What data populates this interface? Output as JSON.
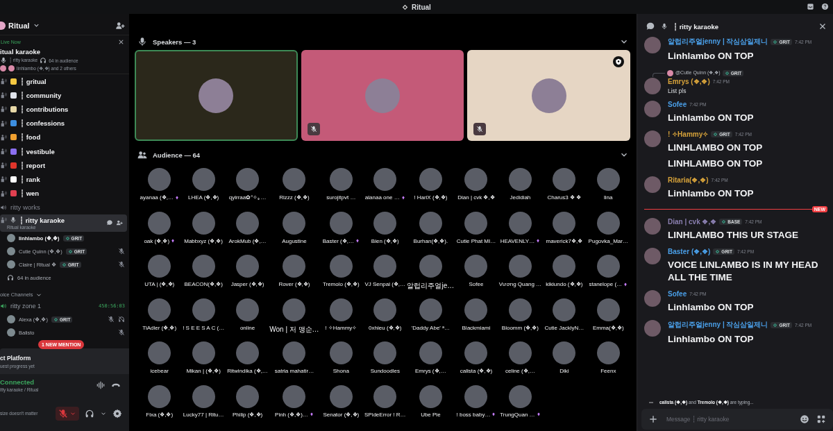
{
  "window": {
    "title": "Ritual"
  },
  "server": {
    "name": "Ritual"
  },
  "live_now": {
    "label": "Live Now",
    "title": "itual karaoke",
    "channel": "┆ ritty karaoke",
    "audience": "64 in audience",
    "speakers": "linhlambo (❖,❖) and 2 others"
  },
  "channels": [
    {
      "name": "┆ gritual",
      "kind": "text",
      "color": "#f5c842"
    },
    {
      "name": "┆ community",
      "kind": "text",
      "color": "#dfe3ea"
    },
    {
      "name": "┆ contributions",
      "kind": "text",
      "color": "#e8d9a8"
    },
    {
      "name": "┆ confessions",
      "kind": "text",
      "color": "#3d8fe0"
    },
    {
      "name": "┆ food",
      "kind": "text",
      "color": "#f0a030"
    },
    {
      "name": "┆ vestibule",
      "kind": "text",
      "color": "#8b6ff0"
    },
    {
      "name": "┆ report",
      "kind": "text",
      "color": "#e0352b"
    },
    {
      "name": "┆ rank",
      "kind": "text",
      "color": "#ffffff"
    },
    {
      "name": "┆ wen",
      "kind": "text",
      "color": "#e04050"
    },
    {
      "name": "ritty works",
      "kind": "voice"
    }
  ],
  "stage_channel": {
    "name": "┆ ritty karaoke",
    "subtitle": "Ritual karaoke",
    "selected": true,
    "audience": "64 in audience",
    "speakers": [
      {
        "name": "linhlambo (❖,❖)",
        "tag": "GRIT",
        "muted": false
      },
      {
        "name": "Cutie Quinn (❖,❖)",
        "tag": "GRIT",
        "muted": true
      },
      {
        "name": "Claire | Ritual ❖",
        "tag": "GRIT",
        "muted": true
      }
    ]
  },
  "voice_section": {
    "label": "oice Channels",
    "channel": "ritty zone 1",
    "timer": "450:56:03",
    "members": [
      {
        "name": "Alexa (❖,❖)",
        "tag": "GRIT",
        "muted": true,
        "deafened": true
      },
      {
        "name": "Balisto",
        "muted": true,
        "deafened": false
      }
    ]
  },
  "mention_badge": "1 NEW MENTION",
  "quest": {
    "title": "ct Platform",
    "subtitle": "uest progress yet"
  },
  "connection": {
    "status": "Connected",
    "channel": "itty karaoke / Ritual"
  },
  "user_panel": {
    "status": "size doesn't matter",
    "mic_muted": true
  },
  "speakers_section": {
    "title": "Speakers — 3",
    "tiles": [
      {
        "color": "#2b281b",
        "speaking": true,
        "muted": false,
        "moderator": false
      },
      {
        "color": "#c45a78",
        "speaking": false,
        "muted": true,
        "moderator": false
      },
      {
        "color": "#e6d6c4",
        "speaking": false,
        "muted": true,
        "moderator": true
      }
    ]
  },
  "audience_section": {
    "title": "Audience — 64",
    "members": [
      {
        "name": "ayanaa (❖,…",
        "boost": true
      },
      {
        "name": "LHEA (❖,❖)",
        "boost": false
      },
      {
        "name": "qyirraa✿°✧｡…",
        "boost": false
      },
      {
        "name": "Rizzz (❖,❖)",
        "boost": false
      },
      {
        "name": "surojitpvt …",
        "boost": false
      },
      {
        "name": "alanaa one …",
        "boost": true
      },
      {
        "name": "! HariX (❖,❖)",
        "boost": false
      },
      {
        "name": "Dian | cvk ❖,❖",
        "boost": false
      },
      {
        "name": "Jedidiah",
        "boost": false
      },
      {
        "name": "Charus3 ❖ ❖",
        "boost": false
      },
      {
        "name": "lina",
        "boost": false
      },
      {
        "name": "oak (❖,❖)",
        "boost": true
      },
      {
        "name": "Mabbxyz (❖,❖)",
        "boost": false
      },
      {
        "name": "ArokMub (❖,…",
        "boost": false
      },
      {
        "name": "Augustine",
        "boost": false
      },
      {
        "name": "Baster (❖,…",
        "boost": true
      },
      {
        "name": "Bien (❖,❖)",
        "boost": false
      },
      {
        "name": "Burhan(❖,❖).",
        "boost": false
      },
      {
        "name": "Cutie Phat MI…",
        "boost": false
      },
      {
        "name": "HEAVENLY…",
        "boost": true
      },
      {
        "name": "maverick7❖,❖",
        "boost": false
      },
      {
        "name": "Pugovka_Mar…",
        "boost": false
      },
      {
        "name": "UTA | (❖,❖)",
        "boost": false
      },
      {
        "name": "BEACON(❖,❖)",
        "boost": false
      },
      {
        "name": "Jasper (❖,❖)",
        "boost": false
      },
      {
        "name": "Rover (❖,❖)",
        "boost": false
      },
      {
        "name": "Tremolo (❖,❖)",
        "boost": false
      },
      {
        "name": "VJ Senpai (❖,…",
        "boost": false
      },
      {
        "name": "알럽리주얼je…",
        "boost": false
      },
      {
        "name": "Sofee",
        "boost": false
      },
      {
        "name": "Vương Quang …",
        "boost": false
      },
      {
        "name": "kikiundo (❖,❖)",
        "boost": false
      },
      {
        "name": "stanelope (…",
        "boost": true
      },
      {
        "name": "TiAdler (❖,❖)",
        "boost": false
      },
      {
        "name": "! S E E S A C (…",
        "boost": false
      },
      {
        "name": "online",
        "boost": false
      },
      {
        "name": "Won | 저 맹순…",
        "boost": false
      },
      {
        "name": "! ✧Hammy✧",
        "boost": false
      },
      {
        "name": "0xhieu (❖,❖)",
        "boost": false
      },
      {
        "name": "'Daddy Abe' ᵃ…",
        "boost": false
      },
      {
        "name": "Blackmiami",
        "boost": false
      },
      {
        "name": "Bloomm (❖,❖)",
        "boost": false
      },
      {
        "name": "Cutie JacklyN…",
        "boost": false
      },
      {
        "name": "Emma(❖,❖)",
        "boost": false
      },
      {
        "name": "icebear",
        "boost": false
      },
      {
        "name": "Mikan | (❖,❖)",
        "boost": false
      },
      {
        "name": "Ritwindika (❖,…",
        "boost": false
      },
      {
        "name": "satria mahatir…",
        "boost": false
      },
      {
        "name": "Shona",
        "boost": false
      },
      {
        "name": "Sundoodles",
        "boost": false
      },
      {
        "name": "Emrys (❖,…",
        "boost": false
      },
      {
        "name": "calista (❖,❖)",
        "boost": false
      },
      {
        "name": "celine (❖,…",
        "boost": false
      },
      {
        "name": "Diki",
        "boost": false
      },
      {
        "name": "Feenx",
        "boost": false
      },
      {
        "name": "Fixa (❖,❖)",
        "boost": false
      },
      {
        "name": "Lucky77 | Ritu…",
        "boost": false
      },
      {
        "name": "Philip (❖,❖)",
        "boost": false
      },
      {
        "name": "Pinh (❖,❖)…",
        "boost": true
      },
      {
        "name": "Senator (❖,❖)",
        "boost": false
      },
      {
        "name": "SPideError ! R…",
        "boost": false
      },
      {
        "name": "Ube Pie",
        "boost": false
      },
      {
        "name": "! boss baby…",
        "boost": true
      },
      {
        "name": "TrungQuan …",
        "boost": true
      }
    ]
  },
  "chat": {
    "title": "┆ ritty karaoke",
    "messages": [
      {
        "kind": "message",
        "author": "알럽리주얼jenny | 작심삼일제니",
        "color": "#4a9fe8",
        "tag": "GRIT",
        "time": "7:42 PM",
        "jumbo": true,
        "lines": [
          "Linhlambo ON TOP"
        ]
      },
      {
        "kind": "message",
        "reply_to": "@Cutie Quinn (❖,❖)",
        "reply_tag": "GRIT",
        "author": "Emrys (❖,❖)",
        "color": "#d6a23a",
        "time": "7:42 PM",
        "jumbo": false,
        "lines": [
          "List pls"
        ]
      },
      {
        "kind": "message",
        "author": "Sofee",
        "color": "#4a9fe8",
        "time": "7:42 PM",
        "jumbo": true,
        "lines": [
          "Linhlambo ON TOP"
        ]
      },
      {
        "kind": "message",
        "author": "! ✧Hammy✧",
        "color": "#d6a23a",
        "tag": "GRIT",
        "time": "7:42 PM",
        "jumbo": true,
        "lines": [
          "LINHLAMBO ON TOP",
          "LINHLAMBO ON TOP"
        ]
      },
      {
        "kind": "message",
        "author": "Ritaria(❖,❖)",
        "color": "#d6a23a",
        "time": "7:42 PM",
        "jumbo": true,
        "lines": [
          "Linhlambo ON TOP"
        ]
      },
      {
        "kind": "divider",
        "label": "NEW"
      },
      {
        "kind": "message",
        "author": "Dian | cvk ❖,❖",
        "color": "#8a7fb0",
        "tag": "BASE",
        "time": "7:42 PM",
        "jumbo": true,
        "lines": [
          "LINHLAMBO THIS UR STAGE"
        ]
      },
      {
        "kind": "message",
        "author": "Baster (❖,❖)",
        "color": "#4a9fe8",
        "tag": "GRIT",
        "time": "7:42 PM",
        "jumbo": true,
        "lines": [
          "VOICE LINLAMBO IS IN MY HEAD ALL THE TIME"
        ]
      },
      {
        "kind": "message",
        "author": "Sofee",
        "color": "#4a9fe8",
        "time": "7:42 PM",
        "jumbo": true,
        "lines": [
          "Linhlambo ON TOP"
        ]
      },
      {
        "kind": "message",
        "author": "알럽리주얼jenny | 작심삼일제니",
        "color": "#4a9fe8",
        "tag": "GRIT",
        "time": "7:42 PM",
        "jumbo": true,
        "lines": [
          "Linhlambo ON TOP"
        ]
      }
    ],
    "typing": "**calista (❖,❖)** and **Tremolo (❖,❖)** are typing...",
    "input": {
      "placeholder": "Message ┆ ritty karaoke"
    }
  }
}
